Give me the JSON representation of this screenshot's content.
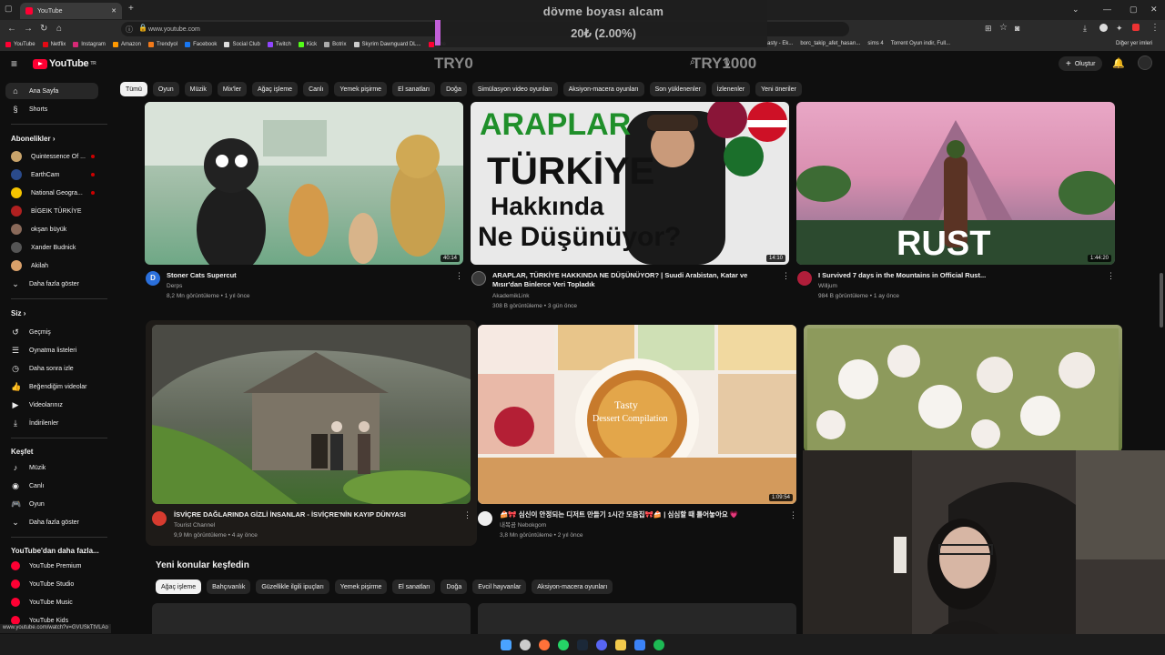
{
  "browser": {
    "tab_title": "YouTube",
    "url": "www.youtube.com",
    "status_url": "www.youtube.com/watch?v=GVUSkTtVLAo",
    "bookmarks": [
      "YouTube",
      "Netflix",
      "Instagram",
      "Amazon",
      "Trendyol",
      "Facebook",
      "Social Club",
      "Twitch",
      "Kick",
      "Botrix",
      "Skyrim Dawnguard DL...",
      "The"
    ],
    "bookmarks_right": [
      "asty - Ek...",
      "borc_takip_afet_hasarı...",
      "sims 4",
      "Torrent Oyun indir, Full..."
    ],
    "other_bookmarks": "Diğer yer imleri"
  },
  "overlay": {
    "donation_title": "dövme boyası alcam",
    "donation_amount": "20₺ (2.00%)",
    "goal_min": "TRY0",
    "goal_max": "TRY1000",
    "progress": 0.02
  },
  "header": {
    "logo": "YouTube",
    "logo_sup": "TR",
    "create_label": "Oluştur"
  },
  "chips": [
    "Tümü",
    "Oyun",
    "Müzik",
    "Mix'ler",
    "Ağaç işleme",
    "Canlı",
    "Yemek pişirme",
    "El sanatları",
    "Doğa",
    "Simülasyon video oyunları",
    "Aksiyon-macera oyunları",
    "Son yüklenenler",
    "İzlenenler",
    "Yeni öneriler"
  ],
  "sidebar": {
    "main": [
      {
        "label": "Ana Sayfa",
        "icon": "home-icon"
      },
      {
        "label": "Shorts",
        "icon": "shorts-icon"
      }
    ],
    "subs_header": "Abonelikler",
    "subs": [
      "Quintessence Of ...",
      "EarthCam",
      "National Geogra...",
      "BİGEIK TÜRKİYE",
      "okşan büyük",
      "Xander Budnick",
      "Akilah"
    ],
    "subs_more": "Daha fazla göster",
    "you_header": "Siz",
    "you": [
      {
        "label": "Geçmiş",
        "icon": "history-icon"
      },
      {
        "label": "Oynatma listeleri",
        "icon": "playlist-icon"
      },
      {
        "label": "Daha sonra izle",
        "icon": "clock-icon"
      },
      {
        "label": "Beğendiğim videolar",
        "icon": "like-icon"
      },
      {
        "label": "Videolarınız",
        "icon": "video-icon"
      },
      {
        "label": "İndirilenler",
        "icon": "download-icon"
      }
    ],
    "explore_header": "Keşfet",
    "explore": [
      {
        "label": "Müzik",
        "icon": "music-icon"
      },
      {
        "label": "Canlı",
        "icon": "live-icon"
      },
      {
        "label": "Oyun",
        "icon": "game-icon"
      }
    ],
    "explore_more": "Daha fazla göster",
    "more_header": "YouTube'dan daha fazla...",
    "more": [
      "YouTube Premium",
      "YouTube Studio",
      "YouTube Music",
      "YouTube Kids"
    ]
  },
  "videos": [
    {
      "title": "Stoner Cats Supercut",
      "channel": "Derps",
      "meta": "8,2 Mn görüntüleme • 1 yıl önce",
      "duration": "40:14"
    },
    {
      "title": "ARAPLAR, TÜRKİYE HAKKINDA NE DÜŞÜNÜYOR? | Suudi Arabistan, Katar ve Mısır'dan Binlerce Veri Topladık",
      "channel": "AkademikLink",
      "meta": "308 B görüntüleme • 3 gün önce",
      "duration": "14:10",
      "thumb_text": [
        "ARAPLAR",
        "TÜRKİYE",
        "Hakkında",
        "Ne Düşünüyor?"
      ]
    },
    {
      "title": "I Survived 7 days in the Mountains in Official Rust...",
      "channel": "Willjum",
      "meta": "984 B görüntüleme • 1 ay önce",
      "duration": "1:44:20",
      "thumb_text": "RUST"
    },
    {
      "title": "İSVİÇRE DAĞLARINDA GİZLİ İNSANLAR - İSVİÇRE'NİN KAYIP DÜNYASI",
      "channel": "Tourist Channel",
      "meta": "9,9 Mn görüntüleme • 4 ay önce"
    },
    {
      "title": "🍰🎀 심신이 안정되는 디저트 만들기 1시간 모음집🎀🍰 | 심심할 때 틀어놓아요 💗",
      "channel": "내복곰 Nebokgom",
      "meta": "3,8 Mn görüntüleme • 2 yıl önce",
      "duration": "1:09:54",
      "thumb_text": [
        "Tasty",
        "Dessert Compilation"
      ]
    }
  ],
  "explore_topics": {
    "title": "Yeni konular keşfedin",
    "chips": [
      "Ağaç işleme",
      "Bahçıvanlık",
      "Güzellikle ilgili ipuçları",
      "Yemek pişirme",
      "El sanatları",
      "Doğa",
      "Evcil hayvanlar",
      "Aksiyon-macera oyunları"
    ]
  },
  "colors": {
    "youtube_red": "#ff0033",
    "background": "#0f0f0f",
    "chip": "#272727",
    "overlay_bar": "#c25fd8"
  }
}
